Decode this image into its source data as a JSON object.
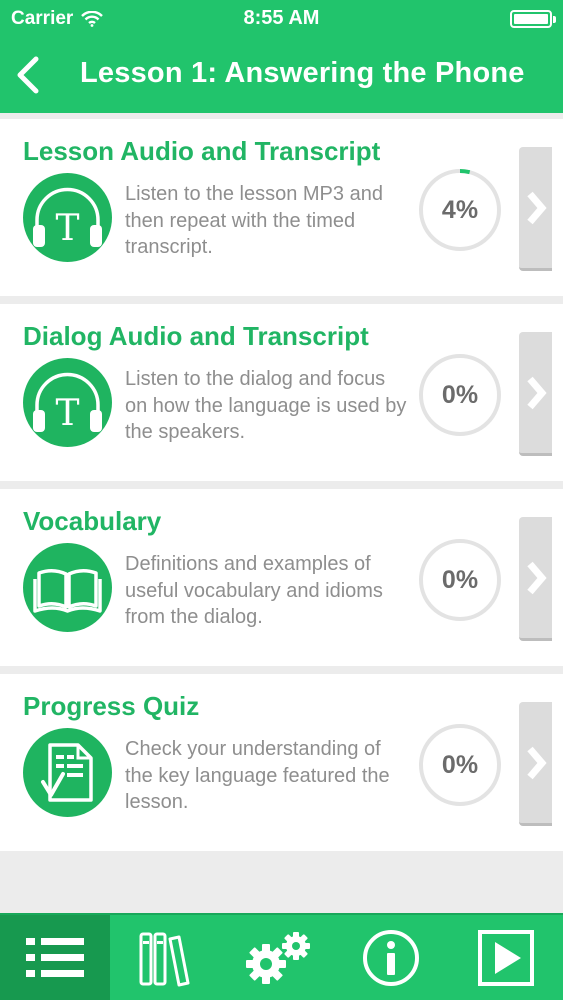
{
  "status": {
    "carrier": "Carrier",
    "time": "8:55 AM"
  },
  "header": {
    "title": "Lesson 1: Answering the Phone"
  },
  "sections": [
    {
      "title": "Lesson Audio and Transcript",
      "description": "Listen to the lesson MP3 and then repeat with the timed transcript.",
      "progress_label": "4%",
      "progress": 0.04,
      "icon": "headphones-transcript-icon"
    },
    {
      "title": "Dialog Audio and Transcript",
      "description": "Listen to the dialog and focus on how the language is used by the speakers.",
      "progress_label": "0%",
      "progress": 0,
      "icon": "headphones-transcript-icon"
    },
    {
      "title": "Vocabulary",
      "description": "Definitions and examples of useful vocabulary and idioms from the dialog.",
      "progress_label": "0%",
      "progress": 0,
      "icon": "open-book-icon"
    },
    {
      "title": "Progress Quiz",
      "description": "Check your understanding of the key language featured the lesson.",
      "progress_label": "0%",
      "progress": 0,
      "icon": "quiz-document-icon"
    }
  ],
  "tabbar": {
    "tabs": [
      {
        "icon": "list-icon",
        "active": true
      },
      {
        "icon": "books-icon",
        "active": false
      },
      {
        "icon": "settings-gears-icon",
        "active": false
      },
      {
        "icon": "info-icon",
        "active": false
      },
      {
        "icon": "play-icon",
        "active": false
      }
    ]
  },
  "colors": {
    "brand": "#21c46c",
    "title_green": "#21b564",
    "icon_bg": "#1fb460"
  }
}
